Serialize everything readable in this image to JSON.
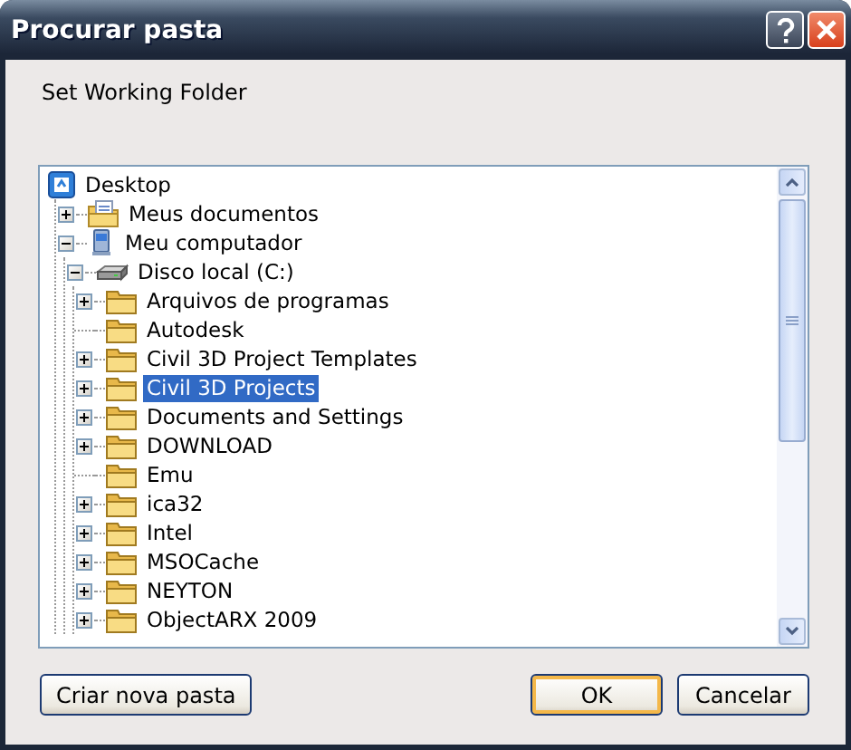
{
  "window": {
    "title": "Procurar pasta"
  },
  "prompt": "Set Working Folder",
  "tree": [
    {
      "kind": "desktop",
      "label": "Desktop",
      "selected": false,
      "children": [
        {
          "kind": "documents",
          "label": "Meus documentos",
          "expanded": false,
          "selected": false
        },
        {
          "kind": "computer",
          "label": "Meu computador",
          "expanded": true,
          "selected": false,
          "children": [
            {
              "kind": "drive",
              "label": "Disco local (C:)",
              "expanded": true,
              "selected": false,
              "children": [
                {
                  "kind": "folder",
                  "label": "Arquivos de programas",
                  "expanded": false,
                  "selected": false
                },
                {
                  "kind": "folder",
                  "label": "Autodesk",
                  "selected": false
                },
                {
                  "kind": "folder",
                  "label": "Civil 3D Project Templates",
                  "expanded": false,
                  "selected": false
                },
                {
                  "kind": "folder",
                  "label": "Civil 3D Projects",
                  "expanded": false,
                  "selected": true
                },
                {
                  "kind": "folder",
                  "label": "Documents and Settings",
                  "expanded": false,
                  "selected": false
                },
                {
                  "kind": "folder",
                  "label": "DOWNLOAD",
                  "expanded": false,
                  "selected": false
                },
                {
                  "kind": "folder",
                  "label": "Emu",
                  "selected": false
                },
                {
                  "kind": "folder",
                  "label": "ica32",
                  "expanded": false,
                  "selected": false
                },
                {
                  "kind": "folder",
                  "label": "Intel",
                  "expanded": false,
                  "selected": false
                },
                {
                  "kind": "folder",
                  "label": "MSOCache",
                  "expanded": false,
                  "selected": false
                },
                {
                  "kind": "folder",
                  "label": "NEYTON",
                  "expanded": false,
                  "selected": false
                },
                {
                  "kind": "folder",
                  "label": "ObjectARX 2009",
                  "expanded": false,
                  "selected": false
                }
              ]
            }
          ]
        }
      ]
    }
  ],
  "buttons": [
    {
      "label": "Criar nova pasta",
      "default": false
    },
    {
      "label": "OK",
      "default": true
    },
    {
      "label": "Cancelar",
      "default": false
    }
  ]
}
